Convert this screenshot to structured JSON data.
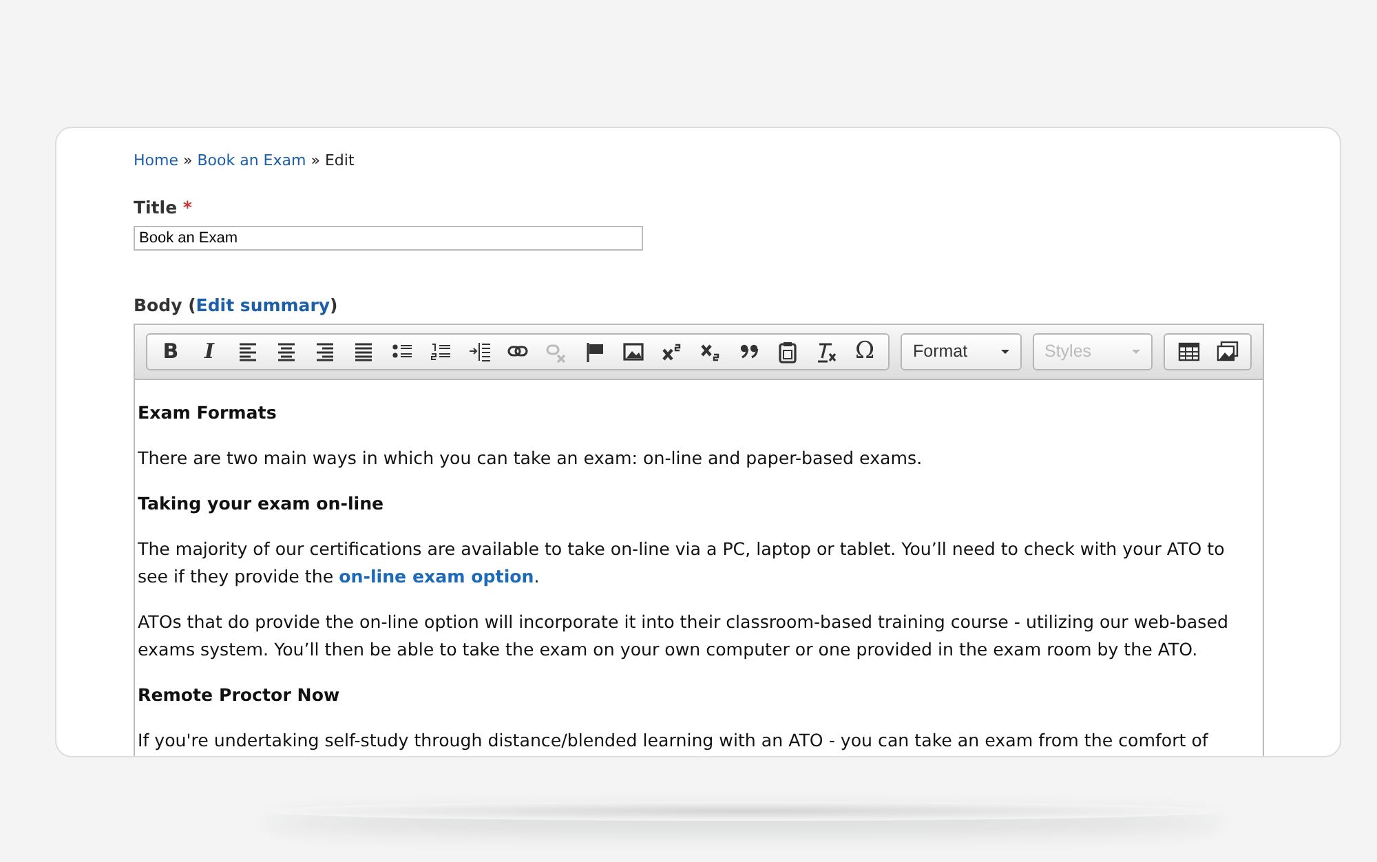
{
  "breadcrumb": [
    {
      "label": "Home",
      "link": true
    },
    {
      "label": "Book an Exam",
      "link": true
    },
    {
      "label": "Edit",
      "link": false
    }
  ],
  "breadcrumb_separator": "»",
  "title_field": {
    "label": "Title",
    "required_mark": "*",
    "value": "Book an Exam"
  },
  "body_field": {
    "label": "Body",
    "open": "(",
    "link": "Edit summary",
    "close": ")"
  },
  "toolbar": [
    {
      "kind": "bold",
      "glyph": "B",
      "disabled": false
    },
    {
      "kind": "italic",
      "glyph": "I",
      "disabled": false
    },
    {
      "kind": "align-left",
      "disabled": false
    },
    {
      "kind": "align-center",
      "disabled": false
    },
    {
      "kind": "align-right",
      "disabled": false
    },
    {
      "kind": "justify",
      "disabled": false
    },
    {
      "kind": "bullets",
      "disabled": false
    },
    {
      "kind": "numbers",
      "disabled": false
    },
    {
      "kind": "indent",
      "disabled": false
    },
    {
      "kind": "link",
      "disabled": false
    },
    {
      "kind": "unlink",
      "disabled": true
    },
    {
      "kind": "flag",
      "disabled": false
    },
    {
      "kind": "image",
      "disabled": false
    },
    {
      "kind": "superscript",
      "disabled": false
    },
    {
      "kind": "subscript",
      "disabled": false
    },
    {
      "kind": "quote",
      "disabled": false
    },
    {
      "kind": "paste",
      "disabled": false
    },
    {
      "kind": "clear",
      "disabled": false
    },
    {
      "kind": "special-character",
      "glyph": "Ω",
      "disabled": false
    }
  ],
  "dropdowns": [
    {
      "label": "Format",
      "disabled": false
    },
    {
      "label": "Styles",
      "disabled": true
    }
  ],
  "toolbar_extra": [
    {
      "kind": "table",
      "disabled": false
    },
    {
      "kind": "gallery",
      "disabled": false
    }
  ],
  "content": [
    {
      "kind": "heading",
      "text": "Exam Formats"
    },
    {
      "kind": "paragraph",
      "text": "There are two main ways in which you can take an exam: on-line and paper-based exams."
    },
    {
      "kind": "heading",
      "text": "Taking your exam on-line"
    },
    {
      "kind": "paragraph",
      "text": "The majority of our certifications are available to take on-line via a PC, laptop or tablet. You’ll need to check with your ATO to see if they provide the ",
      "link": "on-line exam option",
      "after": "."
    },
    {
      "kind": "paragraph",
      "text": "ATOs that do provide the on-line option will incorporate it into their classroom-based training course - utilizing our web-based exams system. You’ll then be able to take the exam on your own computer or one provided in the exam room by the ATO."
    },
    {
      "kind": "heading",
      "text": "Remote Proctor Now"
    },
    {
      "kind": "paragraph",
      "text": "If you're undertaking self-study through distance/blended learning with an ATO - you can take an exam from the comfort of"
    }
  ]
}
